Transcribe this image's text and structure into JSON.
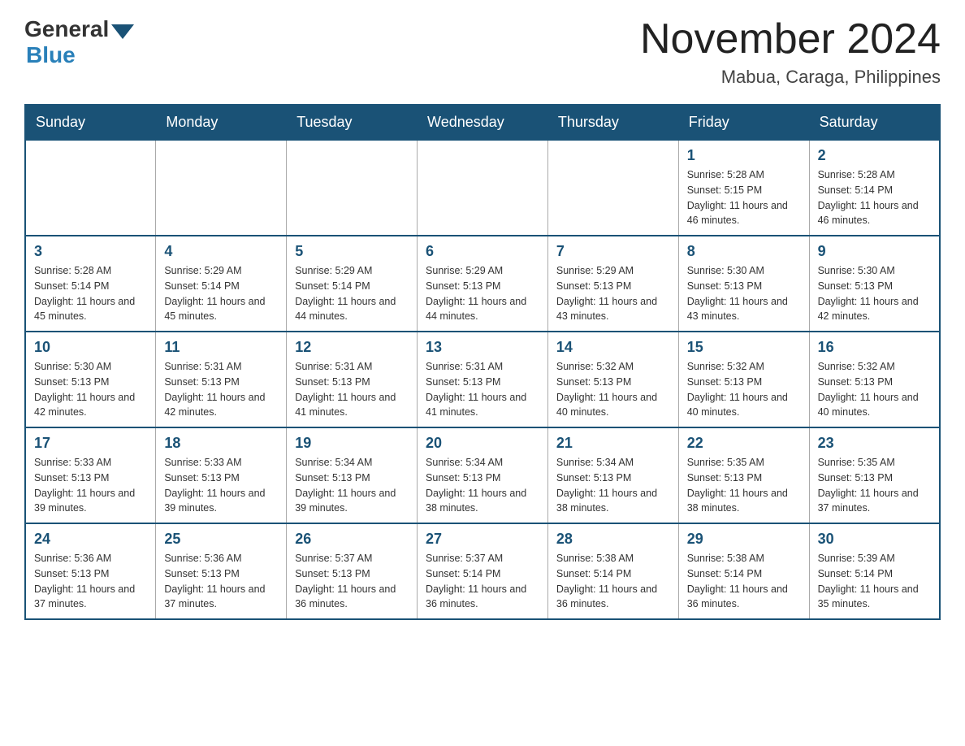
{
  "header": {
    "logo_general": "General",
    "logo_blue": "Blue",
    "month_title": "November 2024",
    "location": "Mabua, Caraga, Philippines"
  },
  "weekdays": [
    "Sunday",
    "Monday",
    "Tuesday",
    "Wednesday",
    "Thursday",
    "Friday",
    "Saturday"
  ],
  "weeks": [
    {
      "days": [
        {
          "num": "",
          "info": ""
        },
        {
          "num": "",
          "info": ""
        },
        {
          "num": "",
          "info": ""
        },
        {
          "num": "",
          "info": ""
        },
        {
          "num": "",
          "info": ""
        },
        {
          "num": "1",
          "info": "Sunrise: 5:28 AM\nSunset: 5:15 PM\nDaylight: 11 hours and 46 minutes."
        },
        {
          "num": "2",
          "info": "Sunrise: 5:28 AM\nSunset: 5:14 PM\nDaylight: 11 hours and 46 minutes."
        }
      ]
    },
    {
      "days": [
        {
          "num": "3",
          "info": "Sunrise: 5:28 AM\nSunset: 5:14 PM\nDaylight: 11 hours and 45 minutes."
        },
        {
          "num": "4",
          "info": "Sunrise: 5:29 AM\nSunset: 5:14 PM\nDaylight: 11 hours and 45 minutes."
        },
        {
          "num": "5",
          "info": "Sunrise: 5:29 AM\nSunset: 5:14 PM\nDaylight: 11 hours and 44 minutes."
        },
        {
          "num": "6",
          "info": "Sunrise: 5:29 AM\nSunset: 5:13 PM\nDaylight: 11 hours and 44 minutes."
        },
        {
          "num": "7",
          "info": "Sunrise: 5:29 AM\nSunset: 5:13 PM\nDaylight: 11 hours and 43 minutes."
        },
        {
          "num": "8",
          "info": "Sunrise: 5:30 AM\nSunset: 5:13 PM\nDaylight: 11 hours and 43 minutes."
        },
        {
          "num": "9",
          "info": "Sunrise: 5:30 AM\nSunset: 5:13 PM\nDaylight: 11 hours and 42 minutes."
        }
      ]
    },
    {
      "days": [
        {
          "num": "10",
          "info": "Sunrise: 5:30 AM\nSunset: 5:13 PM\nDaylight: 11 hours and 42 minutes."
        },
        {
          "num": "11",
          "info": "Sunrise: 5:31 AM\nSunset: 5:13 PM\nDaylight: 11 hours and 42 minutes."
        },
        {
          "num": "12",
          "info": "Sunrise: 5:31 AM\nSunset: 5:13 PM\nDaylight: 11 hours and 41 minutes."
        },
        {
          "num": "13",
          "info": "Sunrise: 5:31 AM\nSunset: 5:13 PM\nDaylight: 11 hours and 41 minutes."
        },
        {
          "num": "14",
          "info": "Sunrise: 5:32 AM\nSunset: 5:13 PM\nDaylight: 11 hours and 40 minutes."
        },
        {
          "num": "15",
          "info": "Sunrise: 5:32 AM\nSunset: 5:13 PM\nDaylight: 11 hours and 40 minutes."
        },
        {
          "num": "16",
          "info": "Sunrise: 5:32 AM\nSunset: 5:13 PM\nDaylight: 11 hours and 40 minutes."
        }
      ]
    },
    {
      "days": [
        {
          "num": "17",
          "info": "Sunrise: 5:33 AM\nSunset: 5:13 PM\nDaylight: 11 hours and 39 minutes."
        },
        {
          "num": "18",
          "info": "Sunrise: 5:33 AM\nSunset: 5:13 PM\nDaylight: 11 hours and 39 minutes."
        },
        {
          "num": "19",
          "info": "Sunrise: 5:34 AM\nSunset: 5:13 PM\nDaylight: 11 hours and 39 minutes."
        },
        {
          "num": "20",
          "info": "Sunrise: 5:34 AM\nSunset: 5:13 PM\nDaylight: 11 hours and 38 minutes."
        },
        {
          "num": "21",
          "info": "Sunrise: 5:34 AM\nSunset: 5:13 PM\nDaylight: 11 hours and 38 minutes."
        },
        {
          "num": "22",
          "info": "Sunrise: 5:35 AM\nSunset: 5:13 PM\nDaylight: 11 hours and 38 minutes."
        },
        {
          "num": "23",
          "info": "Sunrise: 5:35 AM\nSunset: 5:13 PM\nDaylight: 11 hours and 37 minutes."
        }
      ]
    },
    {
      "days": [
        {
          "num": "24",
          "info": "Sunrise: 5:36 AM\nSunset: 5:13 PM\nDaylight: 11 hours and 37 minutes."
        },
        {
          "num": "25",
          "info": "Sunrise: 5:36 AM\nSunset: 5:13 PM\nDaylight: 11 hours and 37 minutes."
        },
        {
          "num": "26",
          "info": "Sunrise: 5:37 AM\nSunset: 5:13 PM\nDaylight: 11 hours and 36 minutes."
        },
        {
          "num": "27",
          "info": "Sunrise: 5:37 AM\nSunset: 5:14 PM\nDaylight: 11 hours and 36 minutes."
        },
        {
          "num": "28",
          "info": "Sunrise: 5:38 AM\nSunset: 5:14 PM\nDaylight: 11 hours and 36 minutes."
        },
        {
          "num": "29",
          "info": "Sunrise: 5:38 AM\nSunset: 5:14 PM\nDaylight: 11 hours and 36 minutes."
        },
        {
          "num": "30",
          "info": "Sunrise: 5:39 AM\nSunset: 5:14 PM\nDaylight: 11 hours and 35 minutes."
        }
      ]
    }
  ]
}
